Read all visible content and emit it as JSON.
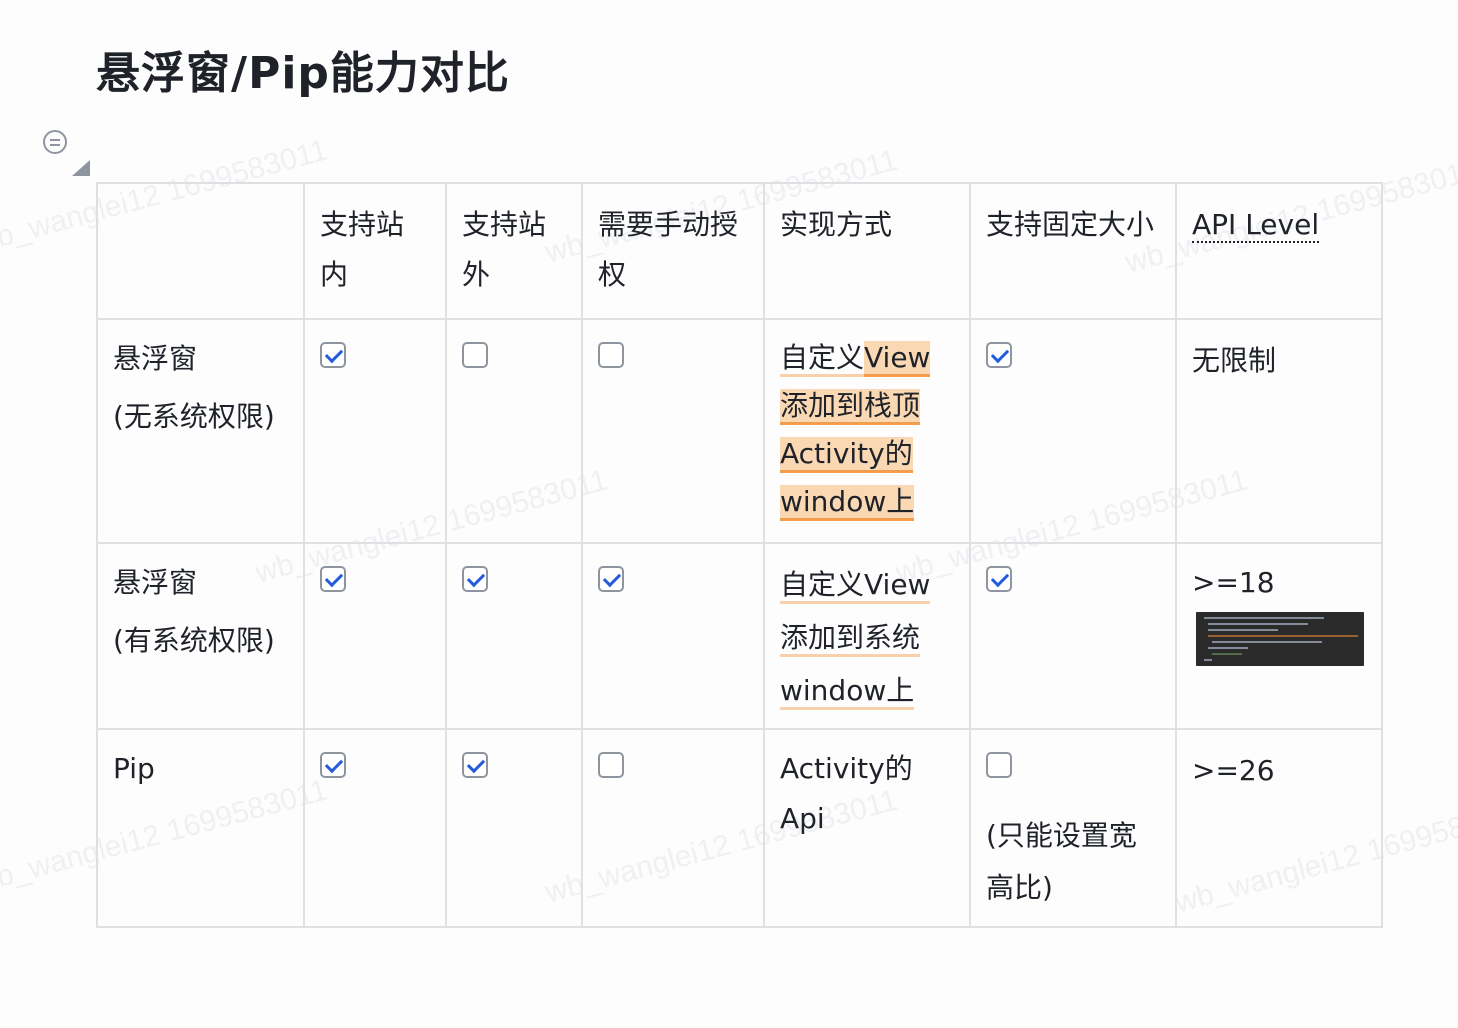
{
  "doc": {
    "title": "悬浮窗/Pip能力对比",
    "watermark": "wb_wanglei12 1699583011"
  },
  "table": {
    "headers": [
      "",
      "支持站内",
      "支持站外",
      "需要手动授权",
      "实现方式",
      "支持固定大小",
      "API Level"
    ],
    "rows": [
      {
        "name": "悬浮窗",
        "sub": "(无系统权限)",
        "in_app": true,
        "out_app": false,
        "manual_auth": false,
        "impl_parts": [
          "自定义",
          "View",
          "添加到栈顶",
          "Activity的",
          "window上"
        ],
        "fixed_size": true,
        "fixed_size_note": "",
        "api_level": "无限制"
      },
      {
        "name": "悬浮窗",
        "sub": "(有系统权限)",
        "in_app": true,
        "out_app": true,
        "manual_auth": true,
        "impl_parts": [
          "自定义View",
          "添加到系统",
          "window上"
        ],
        "fixed_size": true,
        "fixed_size_note": "",
        "api_level": ">=18"
      },
      {
        "name": "Pip",
        "sub": "",
        "in_app": true,
        "out_app": true,
        "manual_auth": false,
        "impl_parts": [
          "Activity的Api"
        ],
        "fixed_size": false,
        "fixed_size_note": "(只能设置宽高比)",
        "api_level": ">=26"
      }
    ]
  },
  "colors": {
    "highlight": "#fad8b4",
    "highlight_line": "#f29d4c",
    "check": "#245bdb",
    "border": "#dee0e3"
  },
  "icons": [
    "outline-icon",
    "table-resize-icon",
    "checkbox-icon",
    "code-screenshot-thumbnail"
  ]
}
